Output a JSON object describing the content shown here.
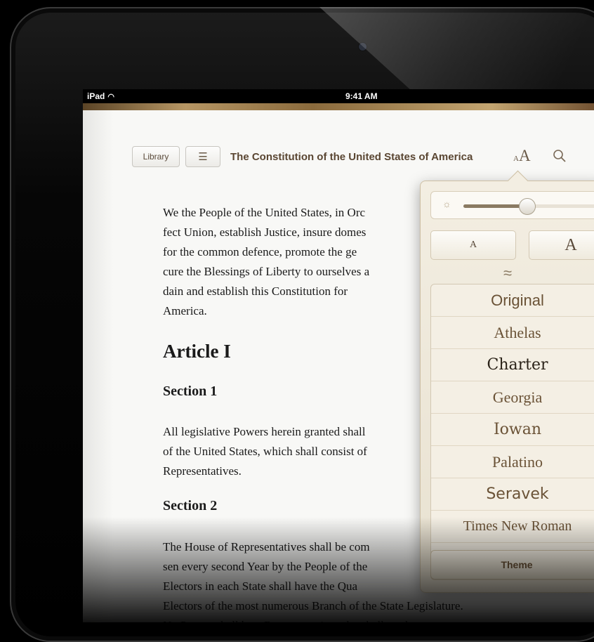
{
  "status_bar": {
    "device": "iPad",
    "time": "9:41 AM"
  },
  "toolbar": {
    "library_label": "Library",
    "book_title": "The Constitution of the United States of America",
    "font_small_a": "A",
    "font_big_a": "A"
  },
  "book": {
    "paragraph_1": "We the People of the United States, in Orc\nfect Union, establish Justice, insure domes\nfor the common defence, promote the ge\ncure the Blessings of Liberty to ourselves a\ndain and establish this Constitution for\nAmerica.",
    "article_heading": "Article I",
    "section_1_heading": "Section 1",
    "paragraph_2": "All legislative Powers herein granted shall\nof the United States, which shall consist of\nRepresentatives.",
    "section_2_heading": "Section 2",
    "paragraph_3": "The House of Representatives shall be com\nsen every second Year by the People of the\nElectors in each State shall have the Qua\nElectors of the most numerous Branch of the State Legislature.\n    No Person shall be a Representative who shall not have at-"
  },
  "font_popover": {
    "brightness_level": 0.45,
    "smaller_label": "A",
    "bigger_label": "A",
    "fonts": [
      "Original",
      "Athelas",
      "Charter",
      "Georgia",
      "Iowan",
      "Palatino",
      "Seravek",
      "Times New Roman"
    ],
    "theme_label": "Theme"
  },
  "colors": {
    "accent_brown": "#6a5236",
    "paper": "#f7f7f5"
  }
}
